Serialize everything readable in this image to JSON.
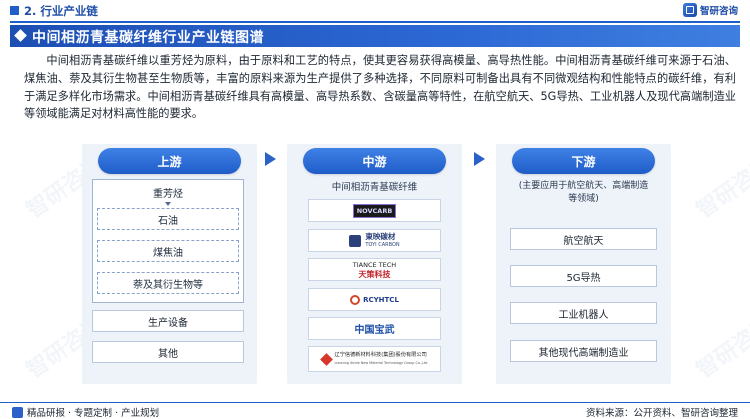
{
  "header": {
    "section": "2. 行业产业链",
    "brand": "智研咨询",
    "title": "中间相沥青基碳纤维行业产业链图谱"
  },
  "intro": "中间相沥青基碳纤维以重芳烃为原料，由于原料和工艺的特点，使其更容易获得高模量、高导热性能。中间相沥青基碳纤维可来源于石油、煤焦油、萘及其衍生物甚至生物质等，丰富的原料来源为生产提供了多种选择，不同原料可制备出具有不同微观结构和性能特点的碳纤维，有利于满足多样化市场需求。中间相沥青基碳纤维具有高模量、高导热系数、含碳量高等特性，在航空航天、5G导热、工业机器人及现代高端制造业等领域能满足对材料高性能的要求。",
  "upstream": {
    "label": "上游",
    "group_lead": "重芳烃",
    "group_items": [
      "石油",
      "煤焦油",
      "萘及其衍生物等"
    ],
    "items": [
      "生产设备",
      "其他"
    ]
  },
  "midstream": {
    "label": "中游",
    "subtitle": "中间相沥青基碳纤维",
    "logos": [
      {
        "icon": "nocarb-logo",
        "text": "NOVCARB"
      },
      {
        "icon": "toyi-carbon-logo",
        "text": "東映碳材",
        "sub": "TOYI CARBON"
      },
      {
        "icon": "tiance-tech-logo",
        "text": "TIANCE TECH",
        "sub": "天策科技"
      },
      {
        "icon": "rcyhtcl-logo",
        "text": "RCYHTCL"
      },
      {
        "icon": "baowu-logo",
        "text": "中国宝武"
      },
      {
        "icon": "liaoning-logo",
        "text": "辽宁信德新材料科技(集团)股份有限公司",
        "sub": "Liaoning Xinde New Material Technology Group Co.,Ltd"
      }
    ]
  },
  "downstream": {
    "label": "下游",
    "subtitle": "(主要应用于航空航天、高端制造等领域)",
    "items": [
      "航空航天",
      "5G导热",
      "工业机器人",
      "其他现代高端制造业"
    ]
  },
  "footer": {
    "left": "精品研报 · 专题定制 · 产业规划",
    "right": "资料来源：公开资料、智研咨询整理"
  },
  "watermark": "智研咨询",
  "colors": {
    "primary": "#1f5fc8",
    "panel_bg": "#eef3fa"
  }
}
